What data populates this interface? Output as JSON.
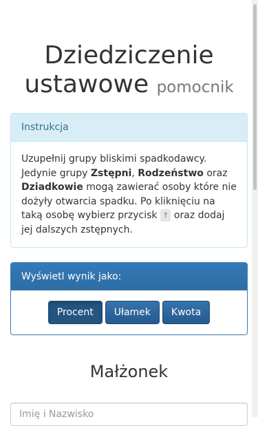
{
  "title": {
    "main_line1": "Dziedziczenie",
    "main_line2": "ustawowe",
    "small": "pomocnik"
  },
  "instructions": {
    "heading": "Instrukcja",
    "text_part1": "Uzupełnij grupy bliskimi spadkodawcy. Jedynie grupy ",
    "group1": "Zstępni",
    "comma": ", ",
    "group2": "Rodzeństwo",
    "oraz": " oraz ",
    "group3": "Dziadkowie",
    "text_part2": " mogą zawierać osoby które nie dożyły otwarcia spadku. Po kliknięciu na taką osobę wybierz przycisk ",
    "cross_symbol": "†",
    "text_part3": " oraz dodaj jej dalszych zstępnych."
  },
  "result_panel": {
    "heading": "Wyświetl wynik jako:",
    "buttons": [
      {
        "label": "Procent",
        "active": true
      },
      {
        "label": "Ułamek",
        "active": false
      },
      {
        "label": "Kwota",
        "active": false
      }
    ]
  },
  "spouse_section": {
    "title": "Małżonek",
    "name_placeholder": "Imię i Nazwisko"
  }
}
